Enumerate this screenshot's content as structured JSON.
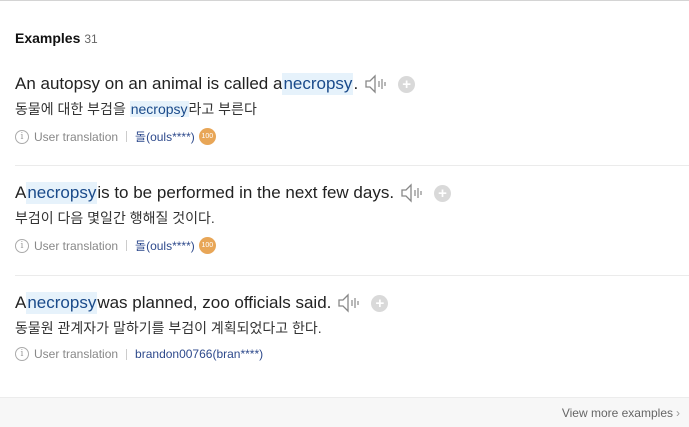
{
  "header": {
    "title": "Examples",
    "count": "31"
  },
  "examples": [
    {
      "en_before": "An autopsy on an animal is called a ",
      "en_keyword": "necropsy",
      "en_after": ".",
      "ko_before": "동물에 대한 부검을 ",
      "ko_keyword": "necropsy",
      "ko_after": "라고 부른다",
      "source": "User translation",
      "user": "돌(ouls****)",
      "badge": "100"
    },
    {
      "en_before": "A ",
      "en_keyword": "necropsy",
      "en_after": " is to be performed in the next few days.",
      "ko_text": "부검이 다음 몇일간 행해질 것이다.",
      "source": "User translation",
      "user": "돌(ouls****)",
      "badge": "100"
    },
    {
      "en_before": "A ",
      "en_keyword": "necropsy",
      "en_after": " was planned, zoo officials said.",
      "ko_text": "동물원 관계자가 말하기를 부검이 계획되었다고 한다.",
      "source": "User translation",
      "user": "brandon00766(bran****)"
    }
  ],
  "icons": {
    "speaker": "speaker-icon",
    "plus": "plus-icon",
    "info": "info-icon",
    "chevron": "chevron-right-icon"
  },
  "colors": {
    "highlight_bg": "#e6f2fb",
    "badge": "#e8a657",
    "user_link": "#2e4a8c"
  },
  "footer": {
    "more_label": "View more examples",
    "chevron": "›"
  }
}
